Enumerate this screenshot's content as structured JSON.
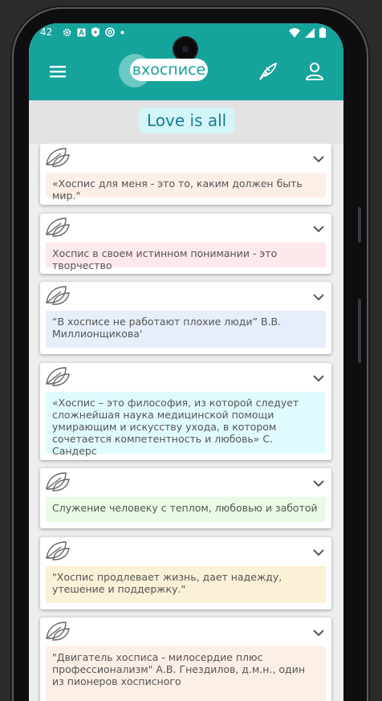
{
  "status": {
    "time": "42"
  },
  "app": {
    "logo_text": "вхосписе"
  },
  "page": {
    "title": "Love is all"
  },
  "colors": {
    "teal": "#16a39c",
    "peach": "#fdeee6",
    "pink": "#fde9ec",
    "blue": "#e6edfb",
    "cyan": "#e0fbfd",
    "green": "#e9fbe4",
    "cream": "#fcf0d6"
  },
  "cards": [
    {
      "text": "«Хоспис для меня - это то, каким должен быть мир.\""
    },
    {
      "text": "Хоспис в своем истинном понимании - это творчество"
    },
    {
      "text": "“В хосписе не работают плохие люди” В.В. Миллионщикова'"
    },
    {
      "text": "«Хоспис – это философия, из которой следует сложнейшая наука медицинской помощи умирающим и искусству ухода, в котором сочетается компетентность и любовь» С. Сандерс"
    },
    {
      "text": "Служение человеку с теплом, любовью и заботой"
    },
    {
      "text": "\"Хоспис продлевает жизнь, дает надежду, утешение и поддержку.\""
    },
    {
      "text": "\"Двигатель хосписа - милосердие плюс профессионализм\" А.В. Гнездилов, д.м.н., один из пионеров хосписного"
    }
  ]
}
